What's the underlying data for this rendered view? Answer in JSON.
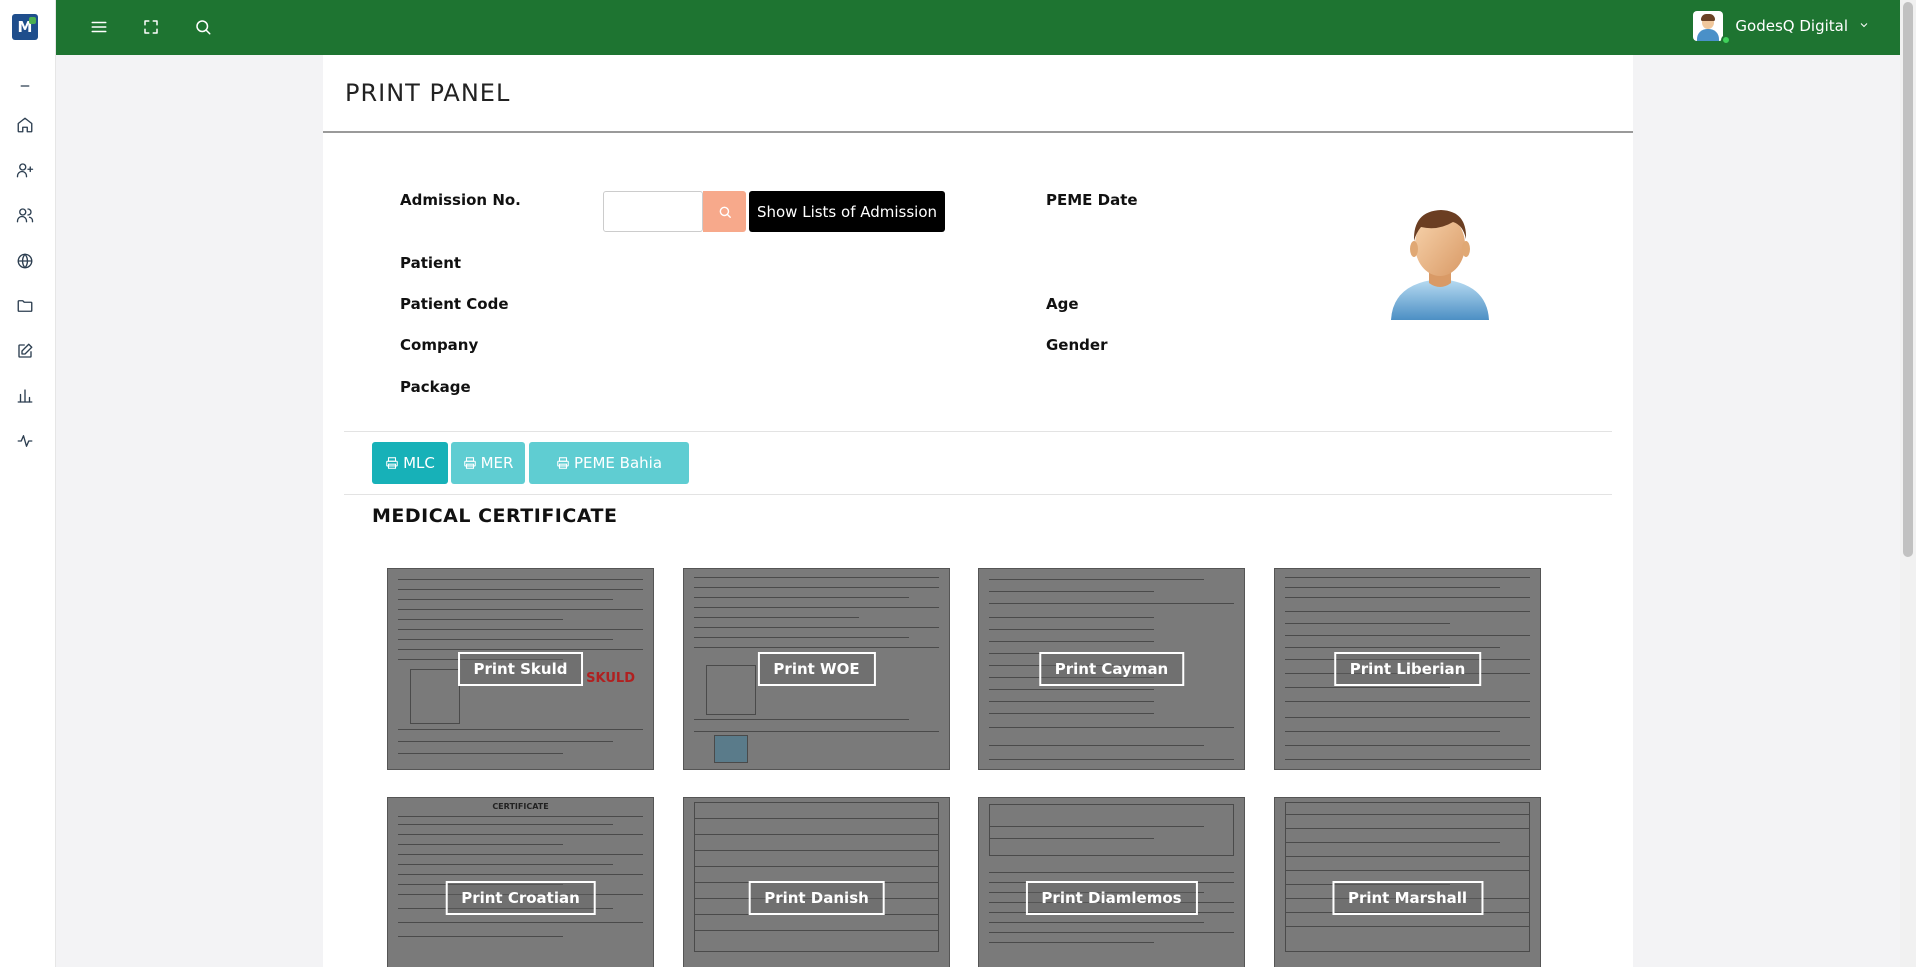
{
  "app": {
    "logo_text": "M",
    "user_name": "GodesQ Digital"
  },
  "sidebar": {
    "items": [
      {
        "icon": "minus-icon",
        "name": "sidebar-item-collapse"
      },
      {
        "icon": "home-icon",
        "name": "sidebar-item-home"
      },
      {
        "icon": "user-plus-icon",
        "name": "sidebar-item-add-patient"
      },
      {
        "icon": "users-icon",
        "name": "sidebar-item-patients"
      },
      {
        "icon": "globe-icon",
        "name": "sidebar-item-globe"
      },
      {
        "icon": "folder-icon",
        "name": "sidebar-item-folder"
      },
      {
        "icon": "edit-icon",
        "name": "sidebar-item-edit"
      },
      {
        "icon": "bar-chart-icon",
        "name": "sidebar-item-reports"
      },
      {
        "icon": "activity-icon",
        "name": "sidebar-item-activity"
      }
    ]
  },
  "topbar": {
    "icons": [
      "menu-icon",
      "fullscreen-icon",
      "search-icon"
    ]
  },
  "panel": {
    "title": "PRINT PANEL",
    "fields": {
      "admission_no": "Admission No.",
      "peme_date": "PEME Date",
      "patient": "Patient",
      "patient_code": "Patient Code",
      "age": "Age",
      "company": "Company",
      "gender": "Gender",
      "package": "Package"
    },
    "admission_input_value": "",
    "show_lists_label": "Show Lists of Admission",
    "print_buttons": {
      "mlc": "MLC",
      "mer": "MER",
      "peme_bahia": "PEME Bahia"
    },
    "section_title": "MEDICAL CERTIFICATE",
    "cards": [
      {
        "label": "Print Skuld"
      },
      {
        "label": "Print WOE"
      },
      {
        "label": "Print Cayman"
      },
      {
        "label": "Print Liberian"
      },
      {
        "label": "Print Croatian"
      },
      {
        "label": "Print Danish"
      },
      {
        "label": "Print Diamlemos"
      },
      {
        "label": "Print Marshall"
      }
    ],
    "skuld_logo": "SKULD",
    "croatian_heading": "CERTIFICATE"
  },
  "colors": {
    "topbar": "#1e7431",
    "primary_button": "#17b1b8",
    "muted_button": "#5fcdd2",
    "search_button": "#f7a98b"
  }
}
